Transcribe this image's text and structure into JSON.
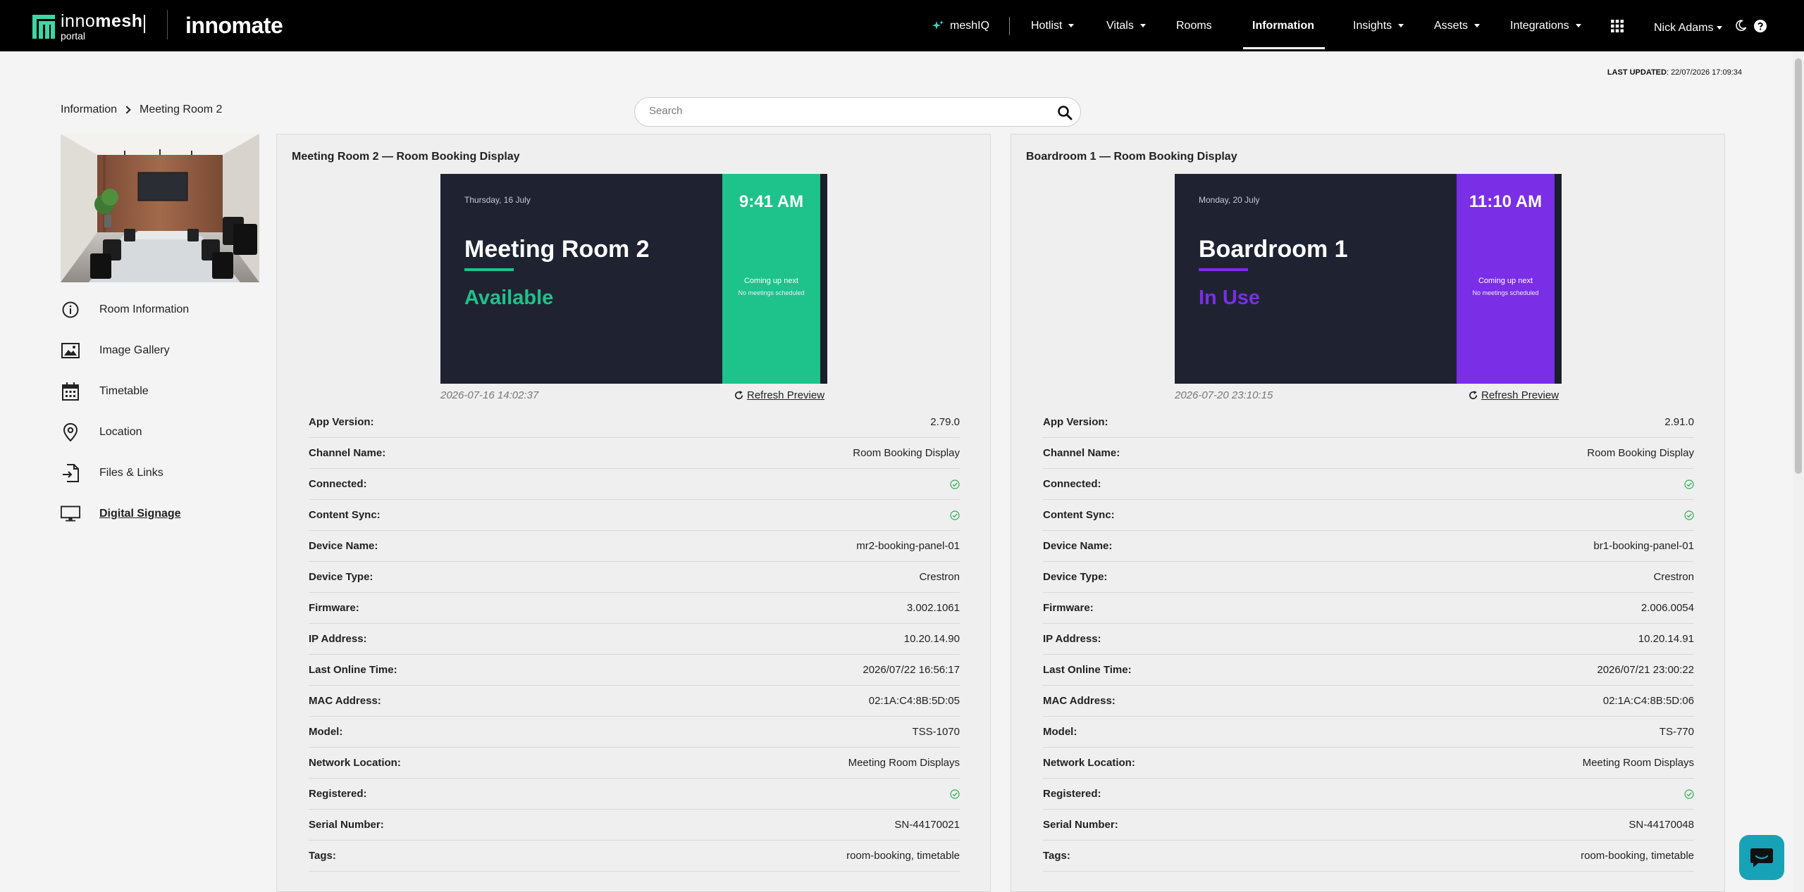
{
  "brand": {
    "logo_word_a": "inno",
    "logo_word_b": "mesh",
    "logo_sub": "portal",
    "secondary": "innomate"
  },
  "nav": {
    "meshiq": "meshIQ",
    "hotlist": "Hotlist",
    "vitals": "Vitals",
    "rooms": "Rooms",
    "information": "Information",
    "insights": "Insights",
    "assets": "Assets",
    "integrations": "Integrations",
    "user": "Nick Adams"
  },
  "updated": {
    "label": "LAST UPDATED",
    "value": ": 22/07/2026 17:09:34"
  },
  "breadcrumb": {
    "parent": "Information",
    "current": "Meeting Room 2"
  },
  "search": {
    "placeholder": "Search"
  },
  "sidebar": {
    "items": [
      {
        "label": "Room Information",
        "icon": "info-icon"
      },
      {
        "label": "Image Gallery",
        "icon": "image-icon"
      },
      {
        "label": "Timetable",
        "icon": "calendar-icon"
      },
      {
        "label": "Location",
        "icon": "location-pin-icon"
      },
      {
        "label": "Files & Links",
        "icon": "file-link-icon"
      },
      {
        "label": "Digital Signage",
        "icon": "monitor-icon",
        "active": true
      }
    ]
  },
  "refresh_label": "Refresh Preview",
  "panels": [
    {
      "title": "Meeting Room 2 — Room Booking Display",
      "accent": "#1ec28b",
      "preview": {
        "date": "Thursday, 16 July",
        "room": "Meeting Room 2",
        "status": "Available",
        "time": "9:41 AM",
        "next": "Coming up next",
        "no_meetings": "No meetings scheduled"
      },
      "timestamp": "2026-07-16 14:02:37",
      "rows": [
        {
          "k": "App Version:",
          "v": "2.79.0"
        },
        {
          "k": "Channel Name:",
          "v": "Room Booking Display"
        },
        {
          "k": "Connected:",
          "v": "check"
        },
        {
          "k": "Content Sync:",
          "v": "check"
        },
        {
          "k": "Device Name:",
          "v": "mr2-booking-panel-01"
        },
        {
          "k": "Device Type:",
          "v": "Crestron"
        },
        {
          "k": "Firmware:",
          "v": "3.002.1061"
        },
        {
          "k": "IP Address:",
          "v": "10.20.14.90"
        },
        {
          "k": "Last Online Time:",
          "v": "2026/07/22 16:56:17"
        },
        {
          "k": "MAC Address:",
          "v": "02:1A:C4:8B:5D:05"
        },
        {
          "k": "Model:",
          "v": "TSS-1070"
        },
        {
          "k": "Network Location:",
          "v": "Meeting Room Displays"
        },
        {
          "k": "Registered:",
          "v": "check"
        },
        {
          "k": "Serial Number:",
          "v": "SN-44170021"
        },
        {
          "k": "Tags:",
          "v": "room-booking, timetable"
        }
      ]
    },
    {
      "title": "Boardroom 1 — Room Booking Display",
      "accent": "#7a2ee6",
      "preview": {
        "date": "Monday, 20 July",
        "room": "Boardroom 1",
        "status": "In Use",
        "time": "11:10 AM",
        "next": "Coming up next",
        "no_meetings": "No meetings scheduled"
      },
      "timestamp": "2026-07-20 23:10:15",
      "rows": [
        {
          "k": "App Version:",
          "v": "2.91.0"
        },
        {
          "k": "Channel Name:",
          "v": "Room Booking Display"
        },
        {
          "k": "Connected:",
          "v": "check"
        },
        {
          "k": "Content Sync:",
          "v": "check"
        },
        {
          "k": "Device Name:",
          "v": "br1-booking-panel-01"
        },
        {
          "k": "Device Type:",
          "v": "Crestron"
        },
        {
          "k": "Firmware:",
          "v": "2.006.0054"
        },
        {
          "k": "IP Address:",
          "v": "10.20.14.91"
        },
        {
          "k": "Last Online Time:",
          "v": "2026/07/21 23:00:22"
        },
        {
          "k": "MAC Address:",
          "v": "02:1A:C4:8B:5D:06"
        },
        {
          "k": "Model:",
          "v": "TS-770"
        },
        {
          "k": "Network Location:",
          "v": "Meeting Room Displays"
        },
        {
          "k": "Registered:",
          "v": "check"
        },
        {
          "k": "Serial Number:",
          "v": "SN-44170048"
        },
        {
          "k": "Tags:",
          "v": "room-booking, timetable"
        }
      ]
    }
  ],
  "colors": {
    "topbar": "#000000",
    "check_green": "#2eaa55",
    "chat_button": "#17a2b8"
  }
}
